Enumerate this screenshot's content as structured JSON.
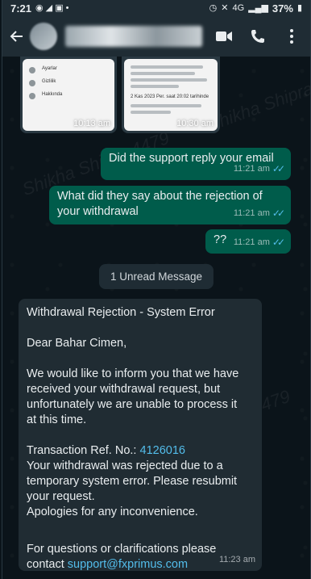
{
  "status_bar": {
    "time": "7:21",
    "battery": "37%",
    "network": "4G"
  },
  "header": {
    "back_icon": "arrow-left-icon",
    "video_icon": "video-call-icon",
    "call_icon": "phone-icon",
    "menu_icon": "more-vertical-icon"
  },
  "media": [
    {
      "rows": [
        "Ayarlar",
        "Gizlilik",
        "Hakkında"
      ],
      "time": "10:13 am"
    },
    {
      "date_text": "2 Kas 2023 Per. saat 20:02 tarihinde",
      "time": "10:30 am"
    }
  ],
  "messages_out": [
    {
      "lines": [
        "Did the support reply your email"
      ],
      "time": "11:21 am"
    },
    {
      "lines": [
        "What did they say about the rejection of",
        "your withdrawal"
      ],
      "time": "11:21 am"
    },
    {
      "lines": [
        "??"
      ],
      "time": "11:21 am"
    }
  ],
  "unread_label": "1 Unread Message",
  "incoming": {
    "subject": "Withdrawal Rejection - System Error",
    "greeting": "Dear Bahar Cimen,",
    "body1": [
      "We would like to inform you that we have",
      "received your withdrawal request, but",
      "unfortunately we are unable to process it",
      "at this time."
    ],
    "ref_label": "Transaction Ref. No.: ",
    "ref_value": "4126016",
    "body2": [
      "Your withdrawal was rejected due to a",
      "temporary system error. Please resubmit",
      "your request.",
      "Apologies for any inconvenience."
    ],
    "closing1": "For questions or clarifications please",
    "closing2_prefix": "contact ",
    "email": "support@fxprimus.com",
    "time": "11:23 am"
  },
  "watermark": "Shikha Shipra 4479",
  "colors": {
    "out_bubble": "#005c4b",
    "in_bubble": "#202c33",
    "link": "#53bdeb",
    "header": "#1f2c34",
    "background": "#0b141a"
  }
}
